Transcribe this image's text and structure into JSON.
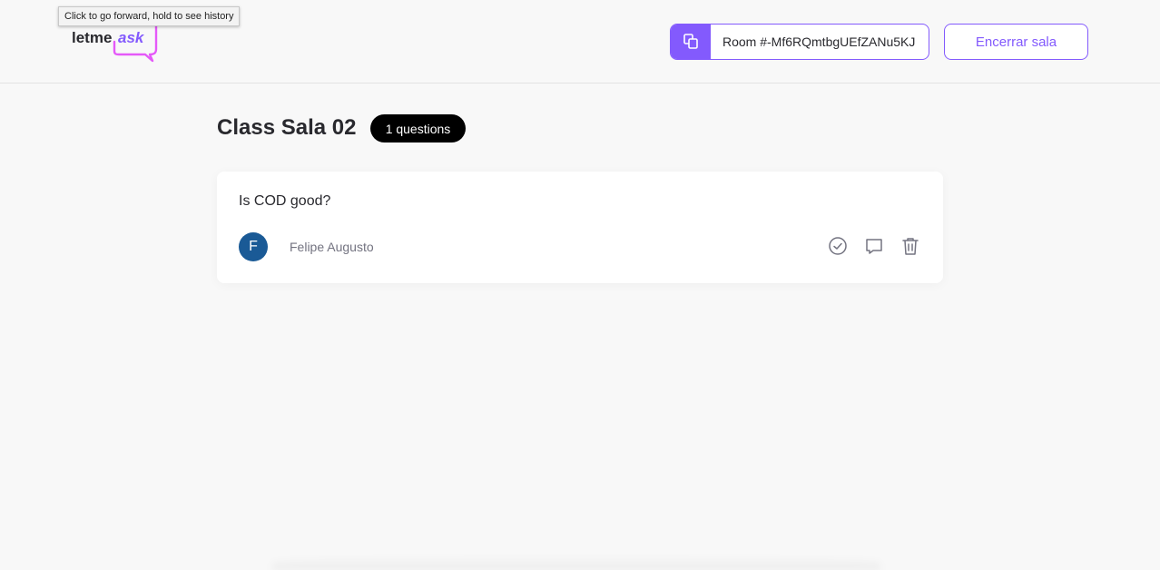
{
  "tooltip": {
    "text": "Click to go forward, hold to see history"
  },
  "logo": {
    "word_left": "letme",
    "word_right": "ask"
  },
  "header": {
    "room_code_label": "Room #-Mf6RQmtbgUEfZANu5KJ",
    "end_room_label": "Encerrar sala"
  },
  "room": {
    "title": "Class Sala 02",
    "question_count": "1 questions"
  },
  "questions": [
    {
      "content": "Is COD good?",
      "author_initial": "F",
      "author_name": "Felipe Augusto"
    }
  ],
  "icons": {
    "copy": "copy-icon",
    "check": "check-circle-icon",
    "answer": "chat-bubble-icon",
    "delete": "trash-icon"
  },
  "colors": {
    "brand": "#835afd",
    "logo_pink": "#e559f9",
    "text": "#29292e",
    "muted": "#737380",
    "avatar": "#1a5a96",
    "badge": "#000000"
  }
}
